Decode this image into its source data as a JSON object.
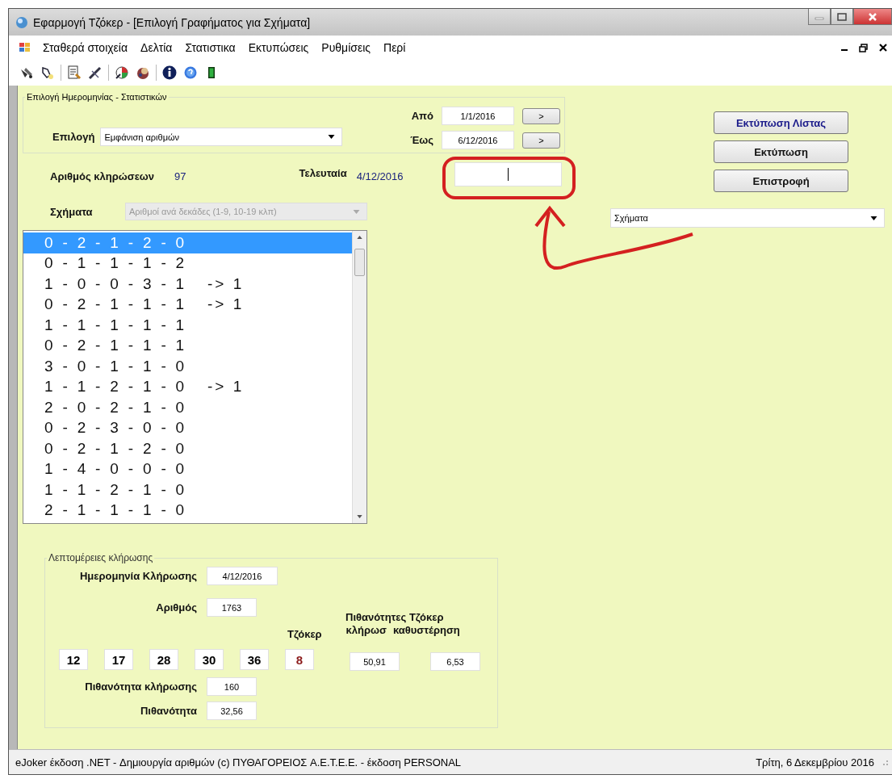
{
  "window": {
    "title": "Εφαρμογή Τζόκερ - [Επιλογή Γραφήματος για Σχήματα]"
  },
  "menu": [
    "Σταθερά στοιχεία",
    "Δελτία",
    "Στατιστικα",
    "Εκτυπώσεις",
    "Ρυθμίσεις",
    "Περί"
  ],
  "date_group": {
    "title": "Επιλογή Ημερομηνίας - Στατιστικών",
    "selection_label": "Επιλογή",
    "selection_value": "Εμφάνιση αριθμών",
    "from_label": "Από",
    "from_value": "1/1/2016",
    "from_button": ">",
    "to_label": "Έως",
    "to_value": "6/12/2016",
    "to_button": ">"
  },
  "buttons": [
    {
      "label": "Εκτύπωση Λίστας",
      "highlight": true
    },
    {
      "label": "Εκτύπωση",
      "highlight": false
    },
    {
      "label": "Επιστροφή",
      "highlight": false
    }
  ],
  "draws": {
    "label": "Αριθμός κληρώσεων",
    "value": "97"
  },
  "last": {
    "label": "Τελευταία",
    "value": "4/12/2016"
  },
  "shapes": {
    "label": "Σχήματα",
    "value": "Αριθμοί ανά δεκάδες (1-9, 10-19 κλπ)",
    "disabled": true
  },
  "shapes_combo": {
    "value": "Σχήματα"
  },
  "pattern_list": [
    {
      "pattern": "0 - 2 - 1 - 2 - 0",
      "selected": true
    },
    {
      "pattern": "0 - 1 - 1 - 1 - 2",
      "selected": false
    },
    {
      "pattern": "1 - 0 - 0 - 3 - 1",
      "suffix": "-> 1",
      "selected": false
    },
    {
      "pattern": "0 - 2 - 1 - 1 - 1",
      "suffix": "-> 1",
      "selected": false
    },
    {
      "pattern": "1 - 1 - 1 - 1 - 1",
      "selected": false
    },
    {
      "pattern": "0 - 2 - 1 - 1 - 1",
      "selected": false
    },
    {
      "pattern": "3 - 0 - 1 - 1 - 0",
      "selected": false
    },
    {
      "pattern": "1 - 1 - 2 - 1 - 0",
      "suffix": "-> 1",
      "selected": false
    },
    {
      "pattern": "2 - 0 - 2 - 1 - 0",
      "selected": false
    },
    {
      "pattern": "0 - 2 - 3 - 0 - 0",
      "selected": false
    },
    {
      "pattern": "0 - 2 - 1 - 2 - 0",
      "selected": false
    },
    {
      "pattern": "1 - 4 - 0 - 0 - 0",
      "selected": false
    },
    {
      "pattern": "1 - 1 - 2 - 1 - 0",
      "selected": false
    },
    {
      "pattern": "2 - 1 - 1 - 1 - 0",
      "selected": false
    }
  ],
  "details": {
    "title": "Λεπτομέρειες κλήρωσης",
    "date_label": "Ημερομηνία Κλήρωσης",
    "date": "4/12/2016",
    "number_label": "Αριθμός",
    "number": "1763",
    "numbers": [
      "12",
      "17",
      "28",
      "30",
      "36"
    ],
    "joker_label": "Τζόκερ",
    "joker": "8",
    "odds_title": "Πιθανότητες Τζόκερ",
    "draw_label": "κλήρωσ",
    "delay_label": "καθυστέρηση",
    "draw_odds": "50,91",
    "delay_odds": "6,53",
    "prob_draw_label": "Πιθανότητα κλήρωσης",
    "prob_draw": "160",
    "prob_label": "Πιθανότητα",
    "prob": "32,56"
  },
  "status_bar": {
    "left": "eJoker έκδοση .NET - Δημιουργία αριθμών (c) ΠΥΘΑΓΟΡΕΙΟΣ A.E.T.E.E. - έκδοση PERSONAL",
    "right": "Τρίτη, 6 Δεκεμβρίου 2016"
  }
}
